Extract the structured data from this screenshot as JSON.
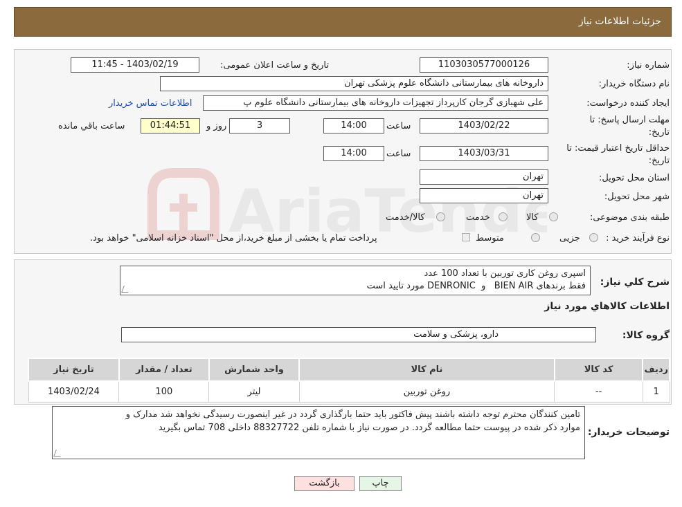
{
  "header": {
    "title": "جزئیات اطلاعات نیاز"
  },
  "details": {
    "need_number_label": "شماره نیاز:",
    "need_number": "1103030577000126",
    "announce_label": "تاریخ و ساعت اعلان عمومی:",
    "announce_value": "1403/02/19 - 11:45",
    "buyer_org_label": "نام دستگاه خریدار:",
    "buyer_org": "داروخانه های بیمارستانی دانشگاه علوم پزشکی تهران",
    "requester_label": "ایجاد کننده درخواست:",
    "requester": "علی شهبازی گرجان کارپرداز تجهیزات داروخانه های بیمارستانی دانشگاه علوم پ",
    "contact_link": "اطلاعات تماس خریدار",
    "deadline_label_1": "مهلت ارسال پاسخ: تا",
    "deadline_label_2": "تاریخ:",
    "deadline_date": "1403/02/22",
    "time_label": "ساعت",
    "deadline_time": "14:00",
    "days_value": "3",
    "days_label": "روز و",
    "remaining_value": "01:44:51",
    "remaining_label": "ساعت باقي مانده",
    "validity_label_1": "حداقل تاريخ اعتبار قيمت: تا",
    "validity_label_2": "تاريخ:",
    "validity_date": "1403/03/31",
    "validity_time": "14:00",
    "province_label": "استان محل تحویل:",
    "province": "تهران",
    "city_label": "شهر محل تحویل:",
    "city": "تهران",
    "category_label": "طبقه بندی موضوعی:",
    "category_options": [
      "کالا",
      "خدمت",
      "کالا/خدمت"
    ],
    "process_label": "نوع فرآیند خرید :",
    "process_options": [
      "جزیی",
      "متوسط"
    ],
    "process_note": "پرداخت تمام یا بخشی از مبلغ خرید،از محل \"اسناد خزانه اسلامی\" خواهد بود."
  },
  "summary": {
    "description_label": "شرح کلي نياز:",
    "description_line1": "اسپری روغن کاری توربین با تعداد 100 عدد",
    "description_line2": "فقط برندهای BIEN AIR   و  DENRONIC مورد تایید است",
    "goods_info_title": "اطلاعات کالاهاي مورد نياز",
    "goods_group_label": "گروه کالا:",
    "goods_group": "دارو، پزشکی و سلامت"
  },
  "table": {
    "headers": [
      "ردیف",
      "کد کالا",
      "نام کالا",
      "واحد شمارش",
      "تعداد / مقدار",
      "تاریخ نیاز"
    ],
    "rows": [
      [
        "1",
        "--",
        "روغن توربین",
        "لیتر",
        "100",
        "1403/02/24"
      ]
    ]
  },
  "buyer_notes": {
    "label": "توضیحات خریدار:",
    "line1": "تامین کنندگان محترم توجه داشته باشند پیش فاکتور باید حتما بارگذاری گردد در غیر اینصورت رسیدگی نخواهد شد مدارک و",
    "line2": "موارد ذکر شده در پیوست حتما مطالعه گردد. در صورت نیاز با شماره تلفن 88327722 داخلی 708 تماس بگیرید"
  },
  "buttons": {
    "print": "چاپ",
    "back": "بازگشت"
  },
  "colors": {
    "header_bg": "#8B6A3E",
    "link": "#1a4fb5",
    "back_button_bg": "#fde0e0",
    "print_button_bg": "#e6f6e6"
  }
}
